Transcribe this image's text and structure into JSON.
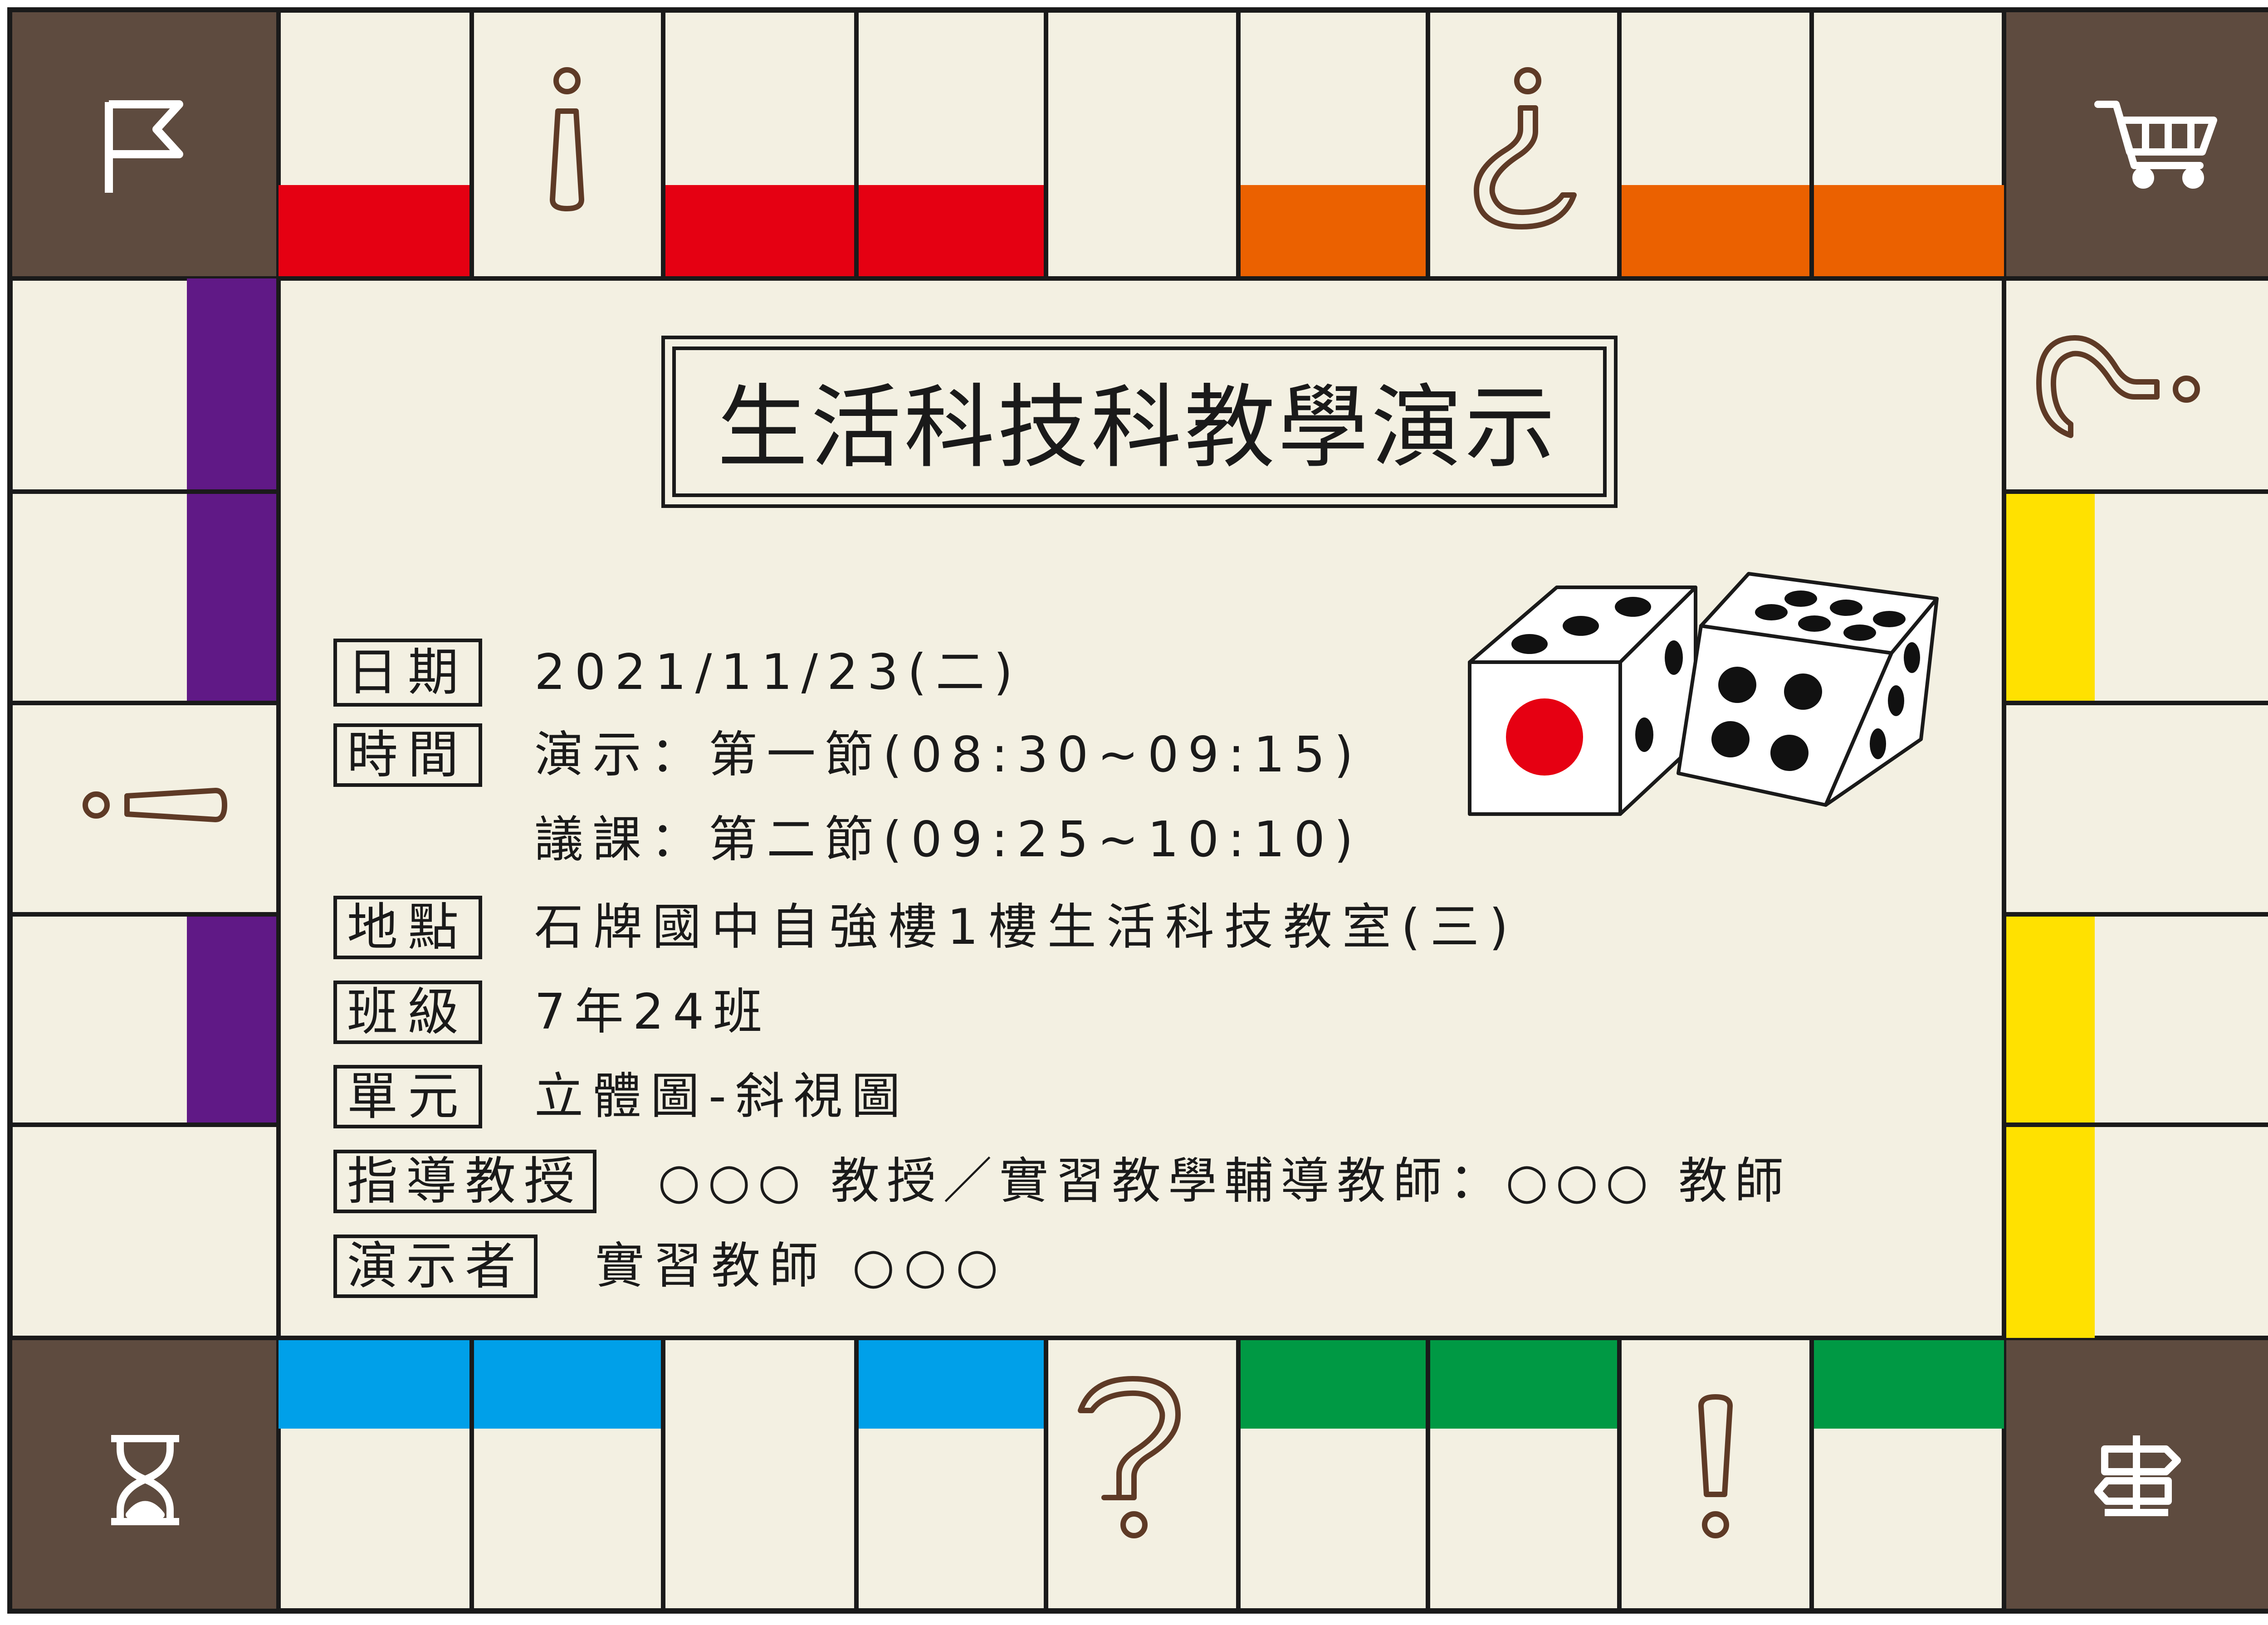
{
  "title": "生活科技科教學演示",
  "rows": {
    "date": {
      "label": "日期",
      "value": "2021/11/23(二)"
    },
    "time": {
      "label": "時間",
      "value1": "演示：第一節(08:30~09:15)",
      "value2": "議課：第二節(09:25~10:10)"
    },
    "place": {
      "label": "地點",
      "value": "石牌國中自強樓1樓生活科技教室(三)"
    },
    "class": {
      "label": "班級",
      "value": "7年24班"
    },
    "unit": {
      "label": "單元",
      "value": "立體圖-斜視圖"
    },
    "advisor": {
      "label": "指導教授",
      "value": "○○○ 教授／實習教學輔導教師：○○○ 教師"
    },
    "presenter": {
      "label": "演示者",
      "value": "實習教師 ○○○"
    }
  },
  "icons": {
    "corner_top_left": "flag-icon",
    "corner_top_right": "shopping-cart-icon",
    "corner_bottom_left": "hourglass-icon",
    "corner_bottom_right": "signpost-icon",
    "board_symbols": [
      "inverted-exclamation-icon",
      "inverted-question-icon",
      "question-mark-icon",
      "exclamation-mark-icon",
      "dice-icon"
    ]
  },
  "colors": {
    "background": "#f3f0e2",
    "corner": "#5e4b3f",
    "line": "#1a1a1a",
    "red": "#e50012",
    "orange": "#eb6100",
    "purple": "#601986",
    "yellow": "#ffe100",
    "blue": "#00a0e9",
    "green": "#009944",
    "symbol": "#5e3a26",
    "dice_dot_red": "#e60012"
  }
}
